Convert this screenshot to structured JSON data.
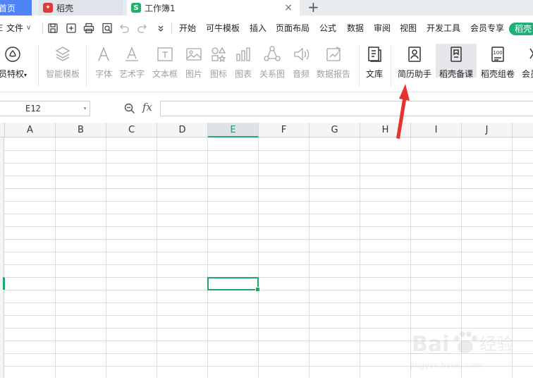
{
  "tabs": {
    "home": "首页",
    "daoke": "稻壳",
    "workbook": "工作簿1",
    "add": "+",
    "close": "×"
  },
  "menubar": {
    "file_prefix": "Ξ",
    "file": "文件",
    "file_caret": "∨",
    "items": [
      "开始",
      "可牛模板",
      "插入",
      "页面布局",
      "公式",
      "数据",
      "审阅",
      "视图",
      "开发工具",
      "会员专享"
    ],
    "green": "稻壳"
  },
  "ribbon": {
    "vip": "员特权",
    "vip_caret": "▾",
    "buttons": [
      {
        "label": "智能模板",
        "icon": "template-icon",
        "enabled": false
      },
      {
        "label": "字体",
        "icon": "font-icon",
        "enabled": false
      },
      {
        "label": "艺术字",
        "icon": "art-text-icon",
        "enabled": false
      },
      {
        "label": "文本框",
        "icon": "textbox-icon",
        "enabled": false
      },
      {
        "label": "图片",
        "icon": "picture-icon",
        "enabled": false
      },
      {
        "label": "图标",
        "icon": "icons-icon",
        "enabled": false
      },
      {
        "label": "图表",
        "icon": "chart-icon",
        "enabled": false
      },
      {
        "label": "关系图",
        "icon": "relation-icon",
        "enabled": false
      },
      {
        "label": "音频",
        "icon": "audio-icon",
        "enabled": false
      },
      {
        "label": "数据报告",
        "icon": "report-icon",
        "enabled": false
      },
      {
        "label": "文库",
        "icon": "library-icon",
        "enabled": true
      },
      {
        "label": "简历助手",
        "icon": "resume-icon",
        "enabled": true
      },
      {
        "label": "稻壳备课",
        "icon": "lesson-icon",
        "enabled": true
      },
      {
        "label": "稻壳组卷",
        "icon": "exam-icon",
        "enabled": true
      },
      {
        "label": "会员",
        "icon": "member-icon",
        "enabled": true
      }
    ],
    "exam_icon_text": "100"
  },
  "formula": {
    "namebox": "E12",
    "fx": "fx",
    "value": ""
  },
  "sheet": {
    "columns": [
      "A",
      "B",
      "C",
      "D",
      "E",
      "F",
      "G",
      "H",
      "I",
      "J"
    ],
    "selected_column": "E",
    "selected_cell": "E12"
  },
  "watermark": {
    "brand": "Bai",
    "brand2": "经验",
    "sub": "jingyan.baidu.com"
  },
  "colors": {
    "accent_green": "#1fa868",
    "tab_blue": "#4e84f8",
    "arrow_red": "#e5342f"
  }
}
